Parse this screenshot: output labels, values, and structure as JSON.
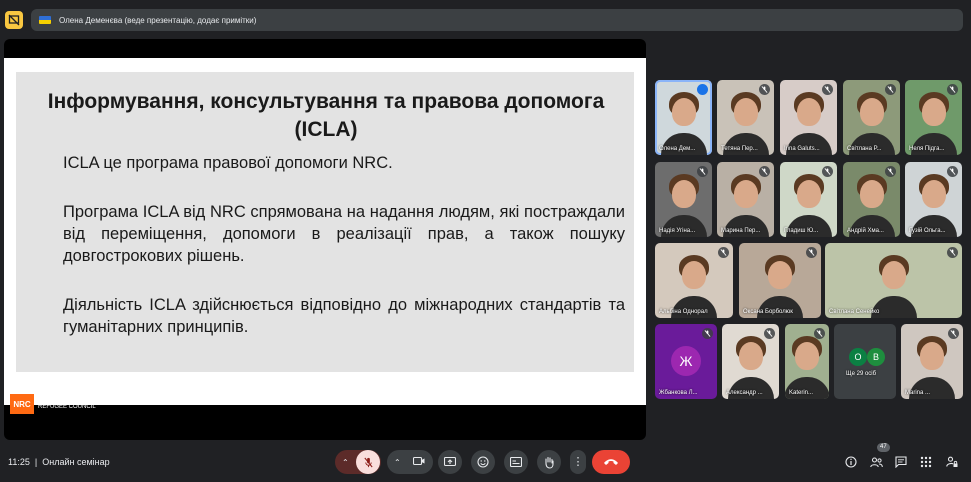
{
  "header": {
    "presenter_text": "Олена Деменєва (веде презентацію, додає примітки)"
  },
  "slide": {
    "title": "Інформування, консультування та правова допомога (ICLA)",
    "p1": "ICLA це програма правової допомоги NRC.",
    "p2": "Програма ICLA від NRC спрямована на надання людям, які постраждали від переміщення, допомоги в реалізації прав, а також пошуку довгострокових рішень.",
    "p3": "Діяльність ICLA здійснюється відповідно до міжнародних стандартів та гуманітарних принципів.",
    "logo_abbr": "NRC",
    "logo_line1": "NORWEGIAN",
    "logo_line2": "REFUGEE COUNCIL"
  },
  "participants": [
    {
      "name": "Олена Дем..."
    },
    {
      "name": "Тетяна Пер..."
    },
    {
      "name": "Irina Galuts..."
    },
    {
      "name": "Світлана Р..."
    },
    {
      "name": "Неля Підга..."
    },
    {
      "name": "Надія Угіна..."
    },
    {
      "name": "Марина Пер..."
    },
    {
      "name": "Гладиш Ю..."
    },
    {
      "name": "Андрій Хма..."
    },
    {
      "name": "Гузій Ольга..."
    },
    {
      "name": "Альбіна Однорал"
    },
    {
      "name": "Оксана Борболюк"
    },
    {
      "name": "Світлана Сенейко"
    },
    {
      "name": "Жбанкова Л...",
      "letter": "Ж"
    },
    {
      "name": "Александр ..."
    },
    {
      "name": "Katerin..."
    },
    {
      "name": "Marina ..."
    }
  ],
  "more_tile": {
    "avatar1": "О",
    "avatar2": "В",
    "label": "Ще 29 осіб"
  },
  "bottom": {
    "time": "11:25",
    "separator": "|",
    "meeting_title": "Онлайн семінар",
    "people_count": "47"
  },
  "colors": {
    "end_call": "#ea4335",
    "mic_off_bg": "#f9dedc",
    "present_icon": "#f9c741",
    "nrc_orange": "#ff6a13"
  }
}
